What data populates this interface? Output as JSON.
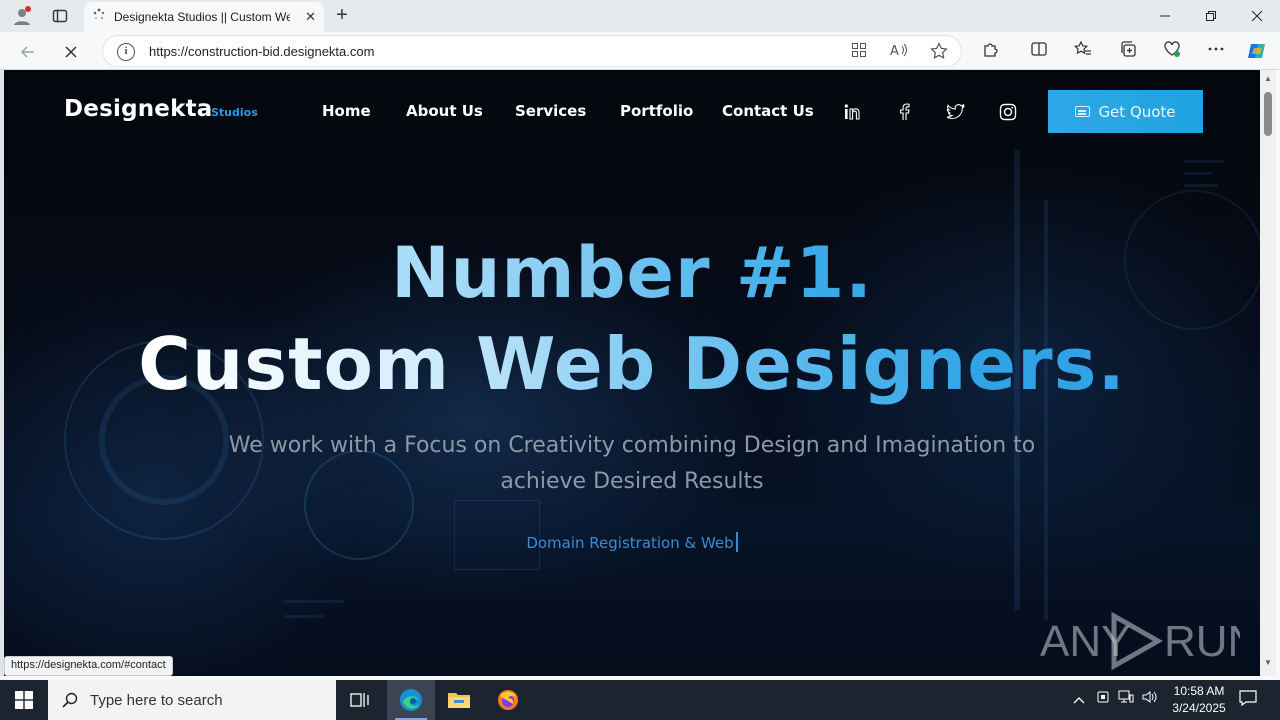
{
  "browser": {
    "tab_title": "Designekta Studios || Custom Web Designers",
    "url": "https://construction-bid.designekta.com",
    "status_url": "https://designekta.com/#contact"
  },
  "site": {
    "logo": "Designekta",
    "logo_sub": "Studios",
    "nav": [
      "Home",
      "About Us",
      "Services",
      "Portfolio",
      "Contact Us"
    ],
    "social_icons": [
      "linkedin-icon",
      "facebook-icon",
      "twitter-icon",
      "instagram-icon"
    ],
    "cta_label": "Get Quote",
    "hero_line1": "Number #1.",
    "hero_line2": "Custom Web Designers.",
    "hero_desc": "We work with a Focus on Creativity combining Design and Imagination to achieve Desired Results",
    "typed_text": "Domain Registration & Web",
    "accent_color": "#2fa7e6"
  },
  "watermark": "ANY RUN",
  "taskbar": {
    "search_placeholder": "Type here to search",
    "time": "10:58 AM",
    "date": "3/24/2025"
  }
}
